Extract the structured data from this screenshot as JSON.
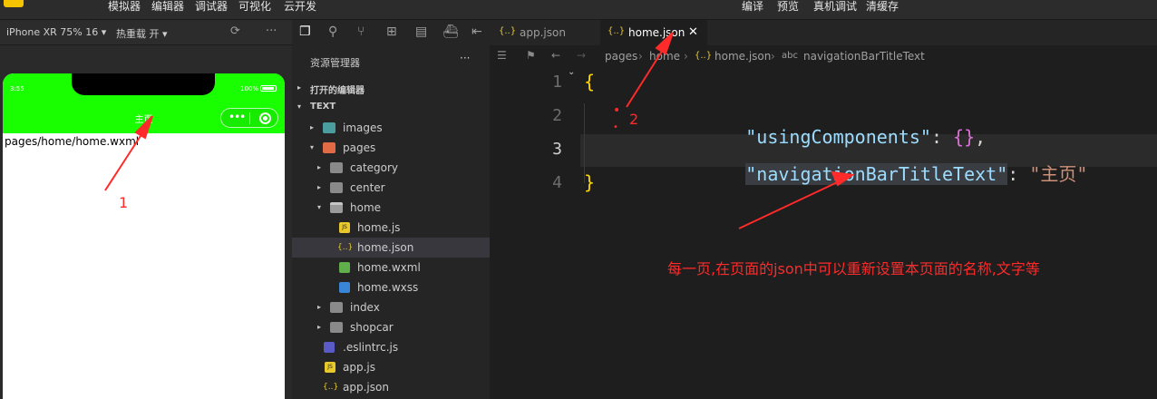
{
  "menubar": {
    "items": [
      "模拟器",
      "编辑器",
      "调试器",
      "可视化",
      "云开发"
    ],
    "right_items": [
      "编译",
      "预览",
      "真机调试",
      "清缓存"
    ]
  },
  "simulator": {
    "device": "iPhone XR 75% 16 ▾",
    "hot_reload": "热重载 开 ▾",
    "status_time": "3:55",
    "battery": "100%",
    "nav_title": "主页",
    "nav_color": "#19ff00",
    "page_text": "pages/home/home.wxml"
  },
  "explorer": {
    "title": "资源管理器",
    "more": "···",
    "open_editors": "打开的编辑器",
    "project": "TEXT",
    "tree": [
      {
        "label": "images",
        "icon": "images-folder-icon"
      },
      {
        "label": "pages",
        "icon": "pages-folder-icon"
      },
      {
        "label": "category",
        "icon": "folder-icon"
      },
      {
        "label": "center",
        "icon": "folder-icon"
      },
      {
        "label": "home",
        "icon": "folder-open-icon"
      },
      {
        "label": "home.js",
        "icon": "js-file-icon"
      },
      {
        "label": "home.json",
        "icon": "json-file-icon"
      },
      {
        "label": "home.wxml",
        "icon": "wxml-file-icon"
      },
      {
        "label": "home.wxss",
        "icon": "css-file-icon"
      },
      {
        "label": "index",
        "icon": "folder-icon"
      },
      {
        "label": "shopcar",
        "icon": "folder-icon"
      },
      {
        "label": ".eslintrc.js",
        "icon": "eslint-file-icon"
      },
      {
        "label": "app.js",
        "icon": "js-file-icon"
      },
      {
        "label": "app.json",
        "icon": "json-file-icon"
      }
    ]
  },
  "tabs": [
    {
      "label": "app.json",
      "active": false
    },
    {
      "label": "home.json",
      "active": true
    }
  ],
  "breadcrumb": [
    "pages",
    "home",
    "home.json",
    "navigationBarTitleText"
  ],
  "editor": {
    "line_numbers": [
      "1",
      "2",
      "3",
      "4"
    ],
    "open_brace": "{",
    "close_brace": "}",
    "line2_key": "\"usingComponents\"",
    "line2_colon": ": ",
    "line2_value": "{}",
    "line2_comma": ",",
    "line3_key": "\"navigationBarTitleText\"",
    "line3_colon": ": ",
    "line3_value": "\"主页\""
  },
  "annotations": {
    "label1": "1",
    "label2": "2",
    "dot": "•",
    "note": "每一页,在页面的json中可以重新设置本页面的名称,文字等",
    "color": "#ff2a2a"
  }
}
